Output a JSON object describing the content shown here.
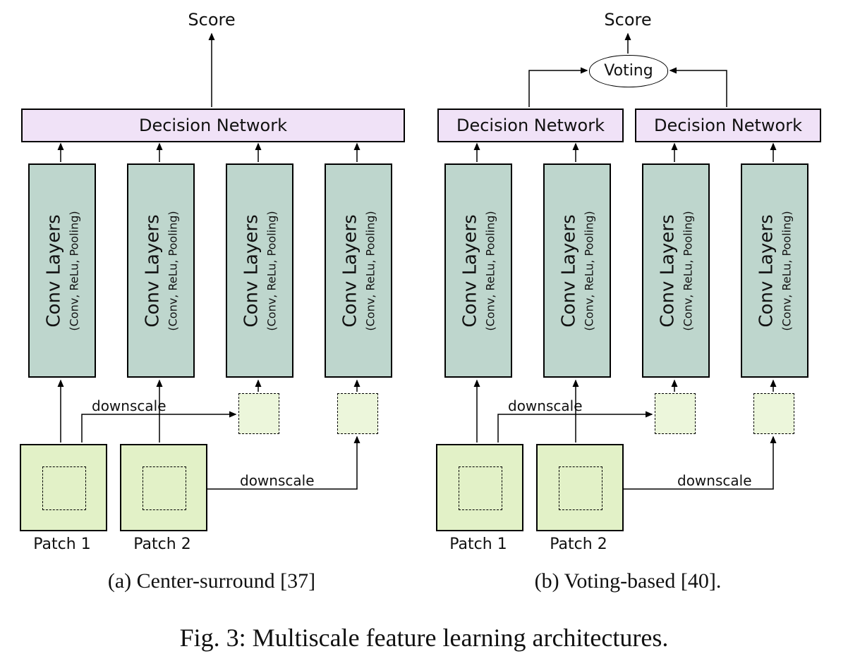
{
  "score_label": "Score",
  "voting_label": "Voting",
  "decision_label": "Decision Network",
  "conv_label_main": "Conv Layers",
  "conv_label_sub": "(Conv, ReLu, Pooling)",
  "downscale_label": "downscale",
  "patch1_label": "Patch 1",
  "patch2_label": "Patch 2",
  "subcaption_a": "(a) Center-surround [37]",
  "subcaption_b": "(b) Voting-based [40].",
  "figure_caption": "Fig. 3:  Multiscale feature learning architectures.",
  "colors": {
    "conv_block": "#bed6cd",
    "decision_block": "#f0e2f7",
    "patch_block": "#e2f1c7",
    "downscaled_block": "#ecf6db"
  }
}
